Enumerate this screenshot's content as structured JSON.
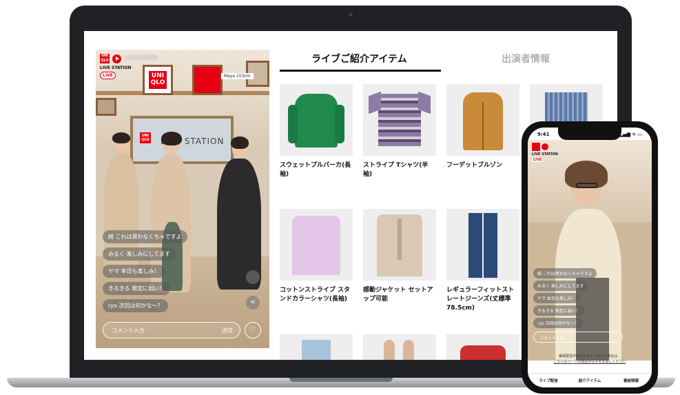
{
  "brand": {
    "logo_text": "UNI QLO",
    "live_station": "LIVE STATION",
    "live_badge": "LIVE",
    "live_station_small": "LIVE STATION"
  },
  "video": {
    "name_tag": "Maya 153cm",
    "tv_text": "LIVE STATION",
    "comments": [
      "綺 これは買わなくちゃですよ",
      "みるく 楽しみにしてます",
      "ヤマ 本日も楽しみ！",
      "きるきる 限定に弱い！",
      "ryo 次回は何かな〜？"
    ],
    "comment_placeholder": "コメント入力",
    "send_label": "送信",
    "heart_icon": "♡",
    "share_icon": "<"
  },
  "tabs": [
    {
      "label": "ライブご紹介アイテム",
      "active": true
    },
    {
      "label": "出演者情報",
      "active": false
    }
  ],
  "items": [
    {
      "name": "スウェットプルパーカ(長袖)",
      "color": "#1f8a4c",
      "type": "hoodie"
    },
    {
      "name": "ストライプ Tシャツ(半袖)",
      "color": "#7a6a8d",
      "type": "tee"
    },
    {
      "name": "フーデットブルゾン",
      "color": "#c98a3a",
      "type": "jacket"
    },
    {
      "name": "",
      "color": "#5c78a8",
      "type": "shirt"
    },
    {
      "name": "コットンストライプ スタンドカラーシャツ(長袖)",
      "color": "#e3c6e8",
      "type": "shirt"
    },
    {
      "name": "感動ジャケット セットアップ可能",
      "color": "#d8c8b4",
      "type": "blazer"
    },
    {
      "name": "レギュラーフィットストレートジーンズ(丈標準78.5cm)",
      "color": "#2c4a78",
      "type": "jeans"
    },
    {
      "name": "",
      "color": "#a7c3da",
      "type": "jeans"
    },
    {
      "name": "",
      "color": "#d9b69a",
      "type": "shoes"
    },
    {
      "name": "",
      "color": "#cc2f2f",
      "type": "bag"
    }
  ],
  "phone": {
    "time": "9:41",
    "status": "▂▄▆ ≋ ▭",
    "live_station": "LIVE STATION",
    "live_badge": "LIVE",
    "comments": [
      "綺 これは買わなくちゃですよ",
      "みるく 楽しみにしてます",
      "ヤマ 本日も楽しみ！",
      "きるきる 限定に弱い！",
      "ryo 次回は何かな〜？"
    ],
    "comment_placeholder": "コメント入力",
    "notice_line1": "番組配信中音がうまくいかない場合は、",
    "notice_line2": "こちらのページの再読み込みをお試しください",
    "nav": [
      "ライブ配信",
      "紹介アイテム",
      "番組情報"
    ]
  }
}
